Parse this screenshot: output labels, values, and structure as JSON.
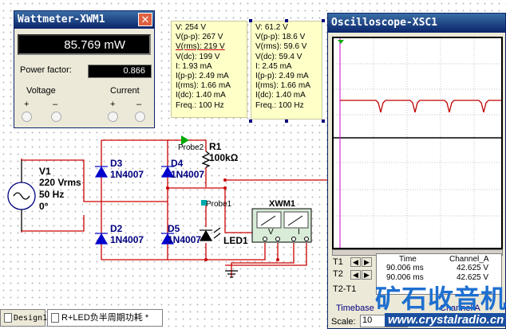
{
  "wattmeter": {
    "title": "Wattmeter-XWM1",
    "reading": "85.769 mW",
    "power_factor_label": "Power factor:",
    "power_factor": "0.866",
    "voltage_label": "Voltage",
    "current_label": "Current",
    "plus": "+",
    "minus": "–",
    "close": "✕"
  },
  "probe2": {
    "lines": [
      "V: 254 V",
      "V(p-p): 267 V",
      "V(rms): 219 V",
      "V(dc): 199 V",
      "I: 1.93 mA",
      "I(p-p): 2.49 mA",
      "I(rms): 1.66 mA",
      "I(dc): 1.40 mA",
      "Freq.: 100 Hz"
    ]
  },
  "probe1": {
    "lines": [
      "V: 61.2 V",
      "V(p-p): 18.6 V",
      "V(rms): 59.6 V",
      "V(dc): 59.4 V",
      "I: 2.45 mA",
      "I(p-p): 2.49 mA",
      "I(rms): 1.66 mA",
      "I(dc): 1.40 mA",
      "Freq.: 100 Hz"
    ]
  },
  "oscilloscope": {
    "title": "Oscilloscope-XSC1",
    "t1": "T1",
    "t2": "T2",
    "t2t1": "T2-T1",
    "col_time": "Time",
    "col_channel": "Channel_A",
    "t1_time": "90.006 ms",
    "t1_value": "42.625 V",
    "t2_time": "90.006 ms",
    "t2_value": "42.625 V",
    "timebase_label": "Timebase",
    "channel_label": "Channel A",
    "scale_label": "Scale:",
    "scale_value": "10",
    "trace_color": "#c00000",
    "screen_color": "#000000",
    "plot_color": "#ffffff"
  },
  "schematic": {
    "source_name": "V1",
    "source_value": "220 Vrms",
    "source_freq": "50 Hz",
    "source_phase": "0°",
    "d1": "D3",
    "d1_part": "1N4007",
    "d2": "D4",
    "d2_part": "1N4007",
    "d3": "D2",
    "d3_part": "1N4007",
    "d4": "D5",
    "d4_part": "1N4007",
    "r1": "R1",
    "r1_value": "100kΩ",
    "probe2_label": "Probe2",
    "probe1_label": "Probe1",
    "led": "LED1",
    "xwm": "XWM1",
    "xwm_v": "V",
    "xwm_i": "I",
    "wire_color": "#cc0000",
    "component_color": "#0000cc"
  },
  "tabs": [
    {
      "label": "Design1"
    },
    {
      "label": "R+LED负半周期功耗 *"
    }
  ],
  "watermark": {
    "cn": "矿石收音机",
    "url": "www.crystalradio.cn"
  }
}
